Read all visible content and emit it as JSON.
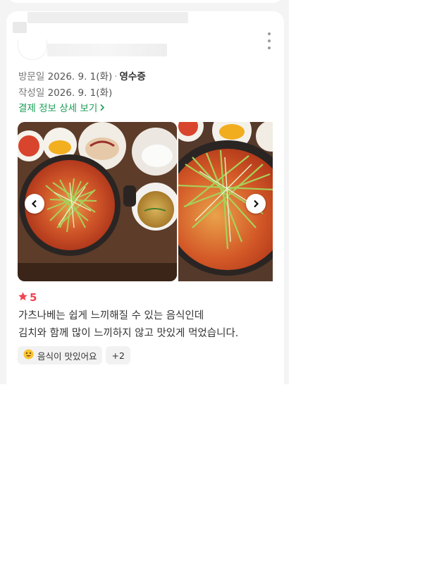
{
  "review": {
    "visit_label": "방문일",
    "visit_date": "2026. 9. 1(화)",
    "visit_separator": "·",
    "receipt_label": "영수증",
    "written_label": "작성일",
    "written_date": "2026. 9. 1(화)",
    "payment_link": "결제 정보 상세 보기",
    "rating": "5",
    "text_line1": "가츠나베는 쉽게 느끼해질 수 있는 음식인데",
    "text_line2": "김치와 함께 많이 느끼하지 않고 맛있게 먹었습니다.",
    "tags": [
      {
        "label": "음식이 맛있어요",
        "icon": "smiling-face-icon"
      },
      {
        "label": "+2"
      }
    ]
  },
  "colors": {
    "accent_green": "#1a9e56",
    "star_red": "#f04452",
    "page_bg": "#f4f4f5"
  }
}
